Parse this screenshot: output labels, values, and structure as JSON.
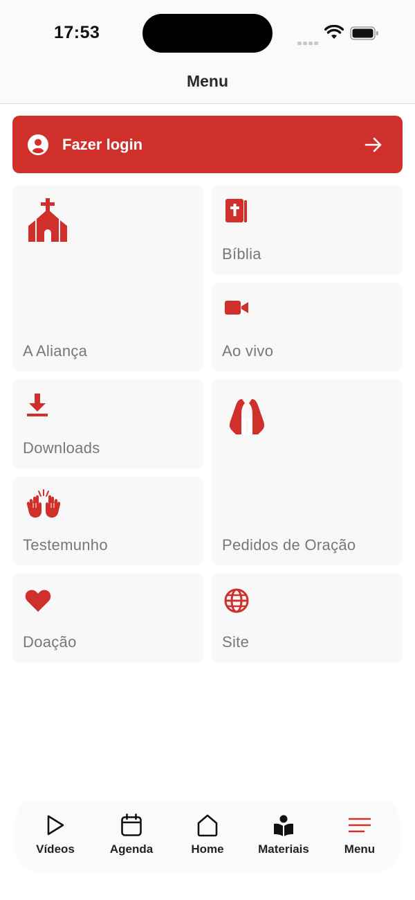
{
  "status_bar": {
    "time": "17:53"
  },
  "header": {
    "title": "Menu"
  },
  "login": {
    "label": "Fazer login"
  },
  "tiles": {
    "alianca": {
      "label": "A Aliança",
      "icon": "church-icon"
    },
    "biblia": {
      "label": "Bíblia",
      "icon": "bible-icon"
    },
    "ao_vivo": {
      "label": "Ao vivo",
      "icon": "video-camera-icon"
    },
    "downloads": {
      "label": "Downloads",
      "icon": "download-icon"
    },
    "pedidos": {
      "label": "Pedidos de Oração",
      "icon": "praying-hands-icon"
    },
    "testemunho": {
      "label": "Testemunho",
      "icon": "raised-hands-icon"
    },
    "doacao": {
      "label": "Doação",
      "icon": "heart-icon"
    },
    "site": {
      "label": "Site",
      "icon": "globe-icon"
    }
  },
  "tab_bar": {
    "tabs": [
      {
        "label": "Vídeos",
        "icon": "play-icon"
      },
      {
        "label": "Agenda",
        "icon": "calendar-icon"
      },
      {
        "label": "Home",
        "icon": "home-icon"
      },
      {
        "label": "Materiais",
        "icon": "book-reader-icon"
      },
      {
        "label": "Menu",
        "icon": "menu-icon"
      }
    ],
    "active": "Menu"
  },
  "colors": {
    "accent": "#d0302b",
    "tile_bg": "#f8f8f8",
    "label": "#777777"
  }
}
